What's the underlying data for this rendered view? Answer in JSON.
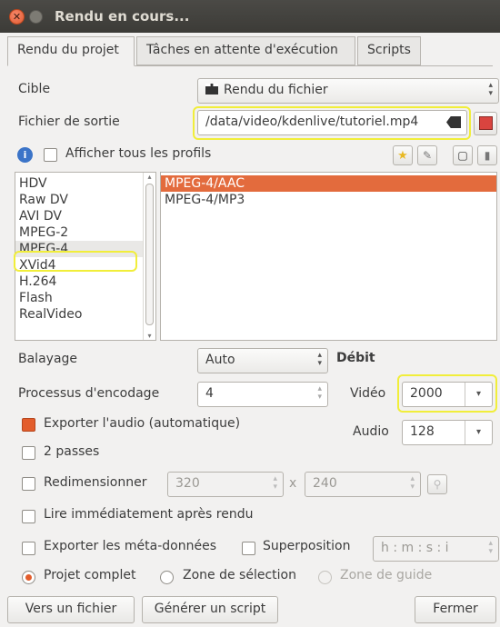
{
  "window": {
    "title": "Rendu en cours...",
    "close_glyph": "✕"
  },
  "tabs": [
    {
      "label": "Rendu du projet"
    },
    {
      "label": "Tâches en attente d'exécution"
    },
    {
      "label": "Scripts"
    }
  ],
  "target": {
    "label": "Cible",
    "value": "Rendu du fichier",
    "icon": "clapperboard-icon"
  },
  "output": {
    "label": "Fichier de sortie",
    "value": "/data/video/kdenlive/tutoriel.mp4"
  },
  "profiles_toggle": {
    "label": "Afficher tous les profils",
    "checked": false,
    "info_glyph": "i"
  },
  "profile_tools": [
    "star-icon",
    "edit-icon",
    "new-document-icon",
    "delete-icon"
  ],
  "formats": {
    "items": [
      "HDV",
      "Raw DV",
      "AVI DV",
      "MPEG-2",
      "MPEG-4",
      "XVid4",
      "H.264",
      "Flash",
      "RealVideo"
    ],
    "selected": "MPEG-4"
  },
  "profiles": {
    "items": [
      "MPEG-4/AAC",
      "MPEG-4/MP3"
    ],
    "selected": "MPEG-4/AAC"
  },
  "scanning": {
    "label": "Balayage",
    "value": "Auto"
  },
  "threads": {
    "label": "Processus d'encodage",
    "value": "4"
  },
  "bitrate": {
    "heading": "Débit",
    "video_label": "Vidéo",
    "video_value": "2000",
    "audio_label": "Audio",
    "audio_value": "128"
  },
  "options": {
    "export_audio": {
      "label": "Exporter l'audio (automatique)",
      "checked": true
    },
    "two_pass": {
      "label": "2 passes",
      "checked": false
    },
    "resize": {
      "label": "Redimensionner",
      "checked": false,
      "width": "320",
      "x": "x",
      "height": "240"
    },
    "play_after": {
      "label": "Lire immédiatement après rendu",
      "checked": false
    },
    "export_meta": {
      "label": "Exporter les méta-données",
      "checked": false
    },
    "overlay": {
      "label": "Superposition",
      "checked": false,
      "timecode": "h : m : s : i"
    }
  },
  "zone": {
    "full": "Projet complet",
    "selection": "Zone de sélection",
    "guide": "Zone de guide",
    "selected": "full"
  },
  "buttons": {
    "to_file": "Vers un fichier",
    "script": "Générer un script",
    "close": "Fermer"
  },
  "colors": {
    "accent": "#e35d2c",
    "highlight": "#f1ee3a",
    "titlebar": "#3c3b37"
  }
}
